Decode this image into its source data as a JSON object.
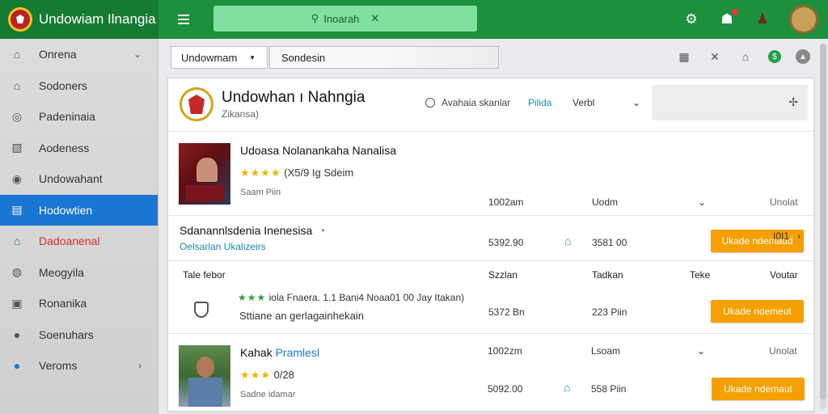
{
  "app": {
    "title": "Undowiam Ilnangia"
  },
  "search": {
    "value": "Inoarah"
  },
  "sidebar": {
    "items": [
      {
        "label": "Onrena",
        "icon": "home-icon",
        "chevron": "⌄"
      },
      {
        "label": "Sodoners",
        "icon": "home-outline-icon",
        "chevron": ""
      },
      {
        "label": "Padeninaia",
        "icon": "circle-target-icon",
        "chevron": ""
      },
      {
        "label": "Aodeness",
        "icon": "image-icon",
        "chevron": ""
      },
      {
        "label": "Undowahant",
        "icon": "circle-icon",
        "chevron": ""
      },
      {
        "label": "Hodowtien",
        "icon": "window-icon",
        "chevron": ""
      },
      {
        "label": "Dadoanenal",
        "icon": "store-icon",
        "chevron": ""
      },
      {
        "label": "Meogyila",
        "icon": "compass-icon",
        "chevron": ""
      },
      {
        "label": "Ronanika",
        "icon": "square-icon",
        "chevron": ""
      },
      {
        "label": "Soenuhars",
        "icon": "disc-icon",
        "chevron": ""
      },
      {
        "label": "Veroms",
        "icon": "globe-icon",
        "chevron": "›"
      }
    ]
  },
  "subbar": {
    "select_value": "Undowmam",
    "input_placeholder": "Sondesin"
  },
  "store": {
    "name": "Undowhan ı Nahngia",
    "subtitle": "Zikansa)",
    "radio_label": "Avahaia skanlar",
    "link_label": "Pilida",
    "select_value": "Verbl"
  },
  "products": [
    {
      "title": "Udoasa Nolanankaha Nanalisa",
      "title_link": "",
      "stars": "★★★★",
      "rating_text": "(X5/9 Ig Sdeim",
      "meta": "Saam Piin",
      "col1_top": "1002am",
      "col1_bottom": "5392.90",
      "col2_top": "Uodm",
      "col2_bottom": "3581 00",
      "col3_top": "Unolat",
      "button": "Ukade ndemaud"
    },
    {
      "title": "Kahak ",
      "title_link": "Pramlesl",
      "stars": "★★★",
      "rating_text": "0/28",
      "meta": "Sadne idamar",
      "col1_top": "1002zm",
      "col1_bottom": "5092.00",
      "col2_top": "Lsoam",
      "col2_bottom": "558 Piin",
      "col3_top": "Unolat",
      "button": "Ukade ndemaut"
    }
  ],
  "section": {
    "title": "Sdanannlsdenia Inenesisa",
    "subtitle": "Oelsarlan Ukalizeirs",
    "right_label": "I0I1"
  },
  "table": {
    "headers": [
      "Tale febor",
      "Szzlan",
      "Tadkan",
      "Teke",
      "Voutar"
    ]
  },
  "mid_row": {
    "stars": "★★★",
    "line1": "iola Fnaera. 1.1 Bani4 Noaa01 00 Jay Itakan)",
    "line2": "Sttiane an gerlagainhekain",
    "col1": "5372 Bn",
    "col2": "223 Piin",
    "button": "Ukade ndemeut"
  },
  "colors": {
    "topbar": "#1e8f3d",
    "search_bg": "#7fe0a0",
    "active_nav": "#1976d2",
    "buy_button": "#f5a000",
    "link": "#1e88a8"
  }
}
